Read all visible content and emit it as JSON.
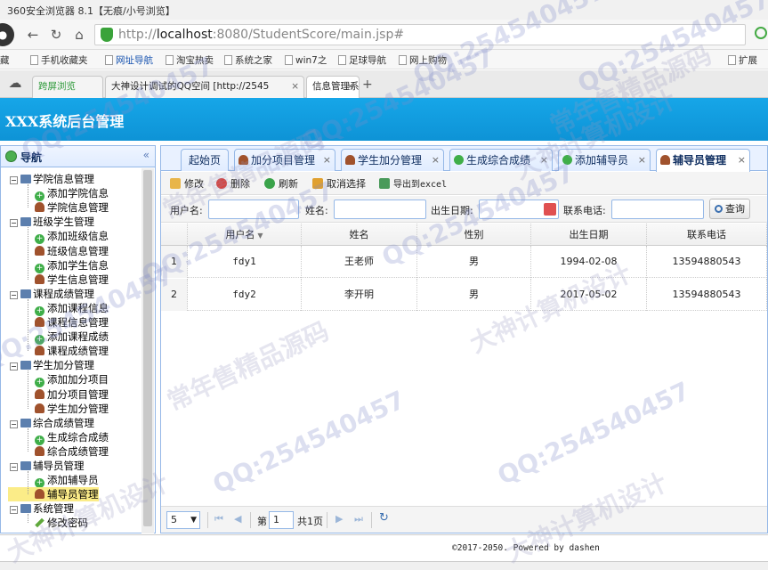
{
  "browser": {
    "title": "360安全浏览器 8.1【无痕/小号浏览】",
    "url_host": "localhost",
    "url_rest": ":8080/StudentScore/main.jsp#",
    "url_scheme": "http://",
    "bookmarks": [
      "藏",
      "手机收藏夹",
      "网址导航",
      "淘宝热卖",
      "系统之家",
      "win7之",
      "足球导航",
      "网上购物"
    ],
    "ext_label": "扩展",
    "tabs": [
      {
        "label": "跨屏浏览"
      },
      {
        "label": "大神设计调试的QQ空间 [http://2545"
      },
      {
        "label": "信息管理系统",
        "active": true
      }
    ]
  },
  "app": {
    "title": "XXX系统后台管理"
  },
  "left_nav": {
    "header": "导航",
    "collapse_icon": "«",
    "groups": [
      {
        "label": "学院信息管理",
        "items": [
          "添加学院信息",
          "学院信息管理"
        ],
        "icons": [
          "plus",
          "person"
        ]
      },
      {
        "label": "班级学生管理",
        "items": [
          "添加班级信息",
          "班级信息管理",
          "添加学生信息",
          "学生信息管理"
        ],
        "icons": [
          "plus",
          "person",
          "plus",
          "person"
        ]
      },
      {
        "label": "课程成绩管理",
        "items": [
          "添加课程信息",
          "课程信息管理",
          "添加课程成绩",
          "课程成绩管理"
        ],
        "icons": [
          "plus",
          "person",
          "plus",
          "person"
        ]
      },
      {
        "label": "学生加分管理",
        "items": [
          "添加加分项目",
          "加分项目管理",
          "学生加分管理"
        ],
        "icons": [
          "plus",
          "person",
          "person"
        ]
      },
      {
        "label": "综合成绩管理",
        "items": [
          "生成综合成绩",
          "综合成绩管理"
        ],
        "icons": [
          "plus",
          "person"
        ]
      },
      {
        "label": "辅导员管理",
        "items": [
          "添加辅导员",
          "辅导员管理"
        ],
        "icons": [
          "plus",
          "person"
        ]
      },
      {
        "label": "系统管理",
        "items": [
          "修改密码"
        ],
        "icons": [
          "pen"
        ]
      }
    ],
    "selected": "辅导员管理"
  },
  "page_tabs": [
    {
      "label": "起始页",
      "closable": false
    },
    {
      "label": "加分项目管理",
      "icon": "person",
      "closable": true
    },
    {
      "label": "学生加分管理",
      "icon": "person",
      "closable": true
    },
    {
      "label": "生成综合成绩",
      "icon": "plus",
      "closable": true
    },
    {
      "label": "添加辅导员",
      "icon": "plus",
      "closable": true
    },
    {
      "label": "辅导员管理",
      "icon": "person",
      "closable": true,
      "active": true
    }
  ],
  "toolbar": {
    "edit": "修改",
    "delete": "删除",
    "refresh": "刷新",
    "cancel_select": "取消选择",
    "export": "导出到excel"
  },
  "search": {
    "username_label": "用户名:",
    "name_label": "姓名:",
    "birthday_label": "出生日期:",
    "phone_label": "联系电话:",
    "query_button": "查询"
  },
  "grid": {
    "columns": [
      "用户名",
      "姓名",
      "性别",
      "出生日期",
      "联系电话"
    ],
    "rows": [
      {
        "n": "1",
        "cells": [
          "fdy1",
          "王老师",
          "男",
          "1994-02-08",
          "13594880543"
        ]
      },
      {
        "n": "2",
        "cells": [
          "fdy2",
          "李开明",
          "男",
          "2017-05-02",
          "13594880543"
        ]
      }
    ]
  },
  "pager": {
    "page_size": "5",
    "page_prefix": "第",
    "page_value": "1",
    "page_total": "共1页"
  },
  "footer": {
    "text": "©2017-2050. Powered by dashen"
  },
  "watermarks": [
    "QQ:254540457",
    "QQ:254540457",
    "QQ:254540457",
    "QQ:254540457",
    "QQ:254540457",
    "QQ:254540457",
    "QQ:254540457",
    "QQ:254540457",
    "QQ:254540457",
    "常年售精品源码",
    "常年售精品源码",
    "常年售精品源码",
    "大神计算机设计",
    "大神计算机设计",
    "大神计算机设计",
    "大神计算机设计"
  ],
  "colors": {
    "header": "#16a6e8",
    "panel_border": "#95b8e7",
    "selected": "#fbec88"
  }
}
